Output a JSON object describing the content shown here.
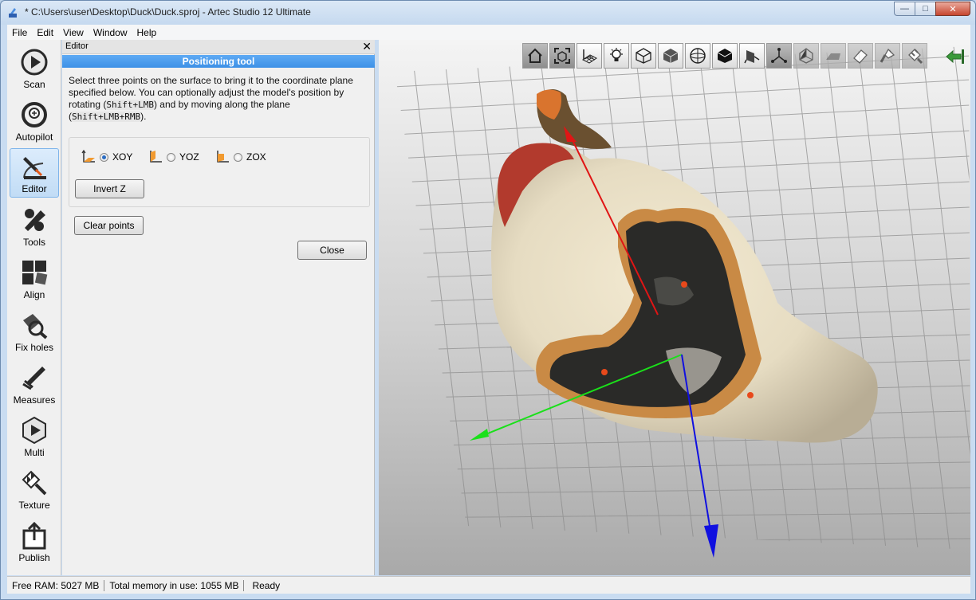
{
  "window": {
    "title": "* C:\\Users\\user\\Desktop\\Duck\\Duck.sproj - Artec Studio 12 Ultimate",
    "minimize_glyph": "—",
    "maximize_glyph": "□",
    "close_glyph": "✕"
  },
  "menu": [
    "File",
    "Edit",
    "View",
    "Window",
    "Help"
  ],
  "left_tools": [
    {
      "label": "Scan",
      "icon": "scan-icon"
    },
    {
      "label": "Autopilot",
      "icon": "autopilot-icon"
    },
    {
      "label": "Editor",
      "icon": "editor-icon",
      "active": true
    },
    {
      "label": "Tools",
      "icon": "tools-icon"
    },
    {
      "label": "Align",
      "icon": "align-icon"
    },
    {
      "label": "Fix holes",
      "icon": "fix-holes-icon"
    },
    {
      "label": "Measures",
      "icon": "measures-icon"
    },
    {
      "label": "Multi",
      "icon": "multi-icon"
    },
    {
      "label": "Texture",
      "icon": "texture-icon"
    },
    {
      "label": "Publish",
      "icon": "publish-icon"
    }
  ],
  "panel": {
    "header": "Editor",
    "close_glyph": "✕",
    "tool_title": "Positioning tool",
    "instructions": {
      "part1": "Select three points on the surface to bring it to the coordinate plane specified below. You can optionally adjust the model's position by rotating (",
      "shortcut1": "Shift+LMB",
      "part2": ") and by moving along the plane (",
      "shortcut2": "Shift+LMB+RMB",
      "part3": ")."
    },
    "planes": [
      {
        "label": "XOY",
        "checked": true
      },
      {
        "label": "YOZ",
        "checked": false
      },
      {
        "label": "ZOX",
        "checked": false
      }
    ],
    "invert_z": "Invert Z",
    "clear_points": "Clear points",
    "close": "Close"
  },
  "viewport_toolbar": [
    "home-view-icon",
    "fit-view-icon",
    "grid-icon",
    "light-bulb-icon",
    "wireframe-icon",
    "solid-icon",
    "sphere-icon",
    "textured-icon",
    "positioning-icon",
    "axes-icon",
    "pivot-icon",
    "iron-icon",
    "eraser-icon",
    "brush-icon",
    "texture-brush-icon"
  ],
  "status": {
    "free_ram": "Free RAM: 5027 MB",
    "total_memory": "Total memory in use: 1055 MB",
    "state": "Ready"
  },
  "colors": {
    "accent": "#3d90e6",
    "axis_x": "#e01515",
    "axis_y": "#1ae01a",
    "axis_z": "#1010e0",
    "point_marker": "#e8491b"
  }
}
